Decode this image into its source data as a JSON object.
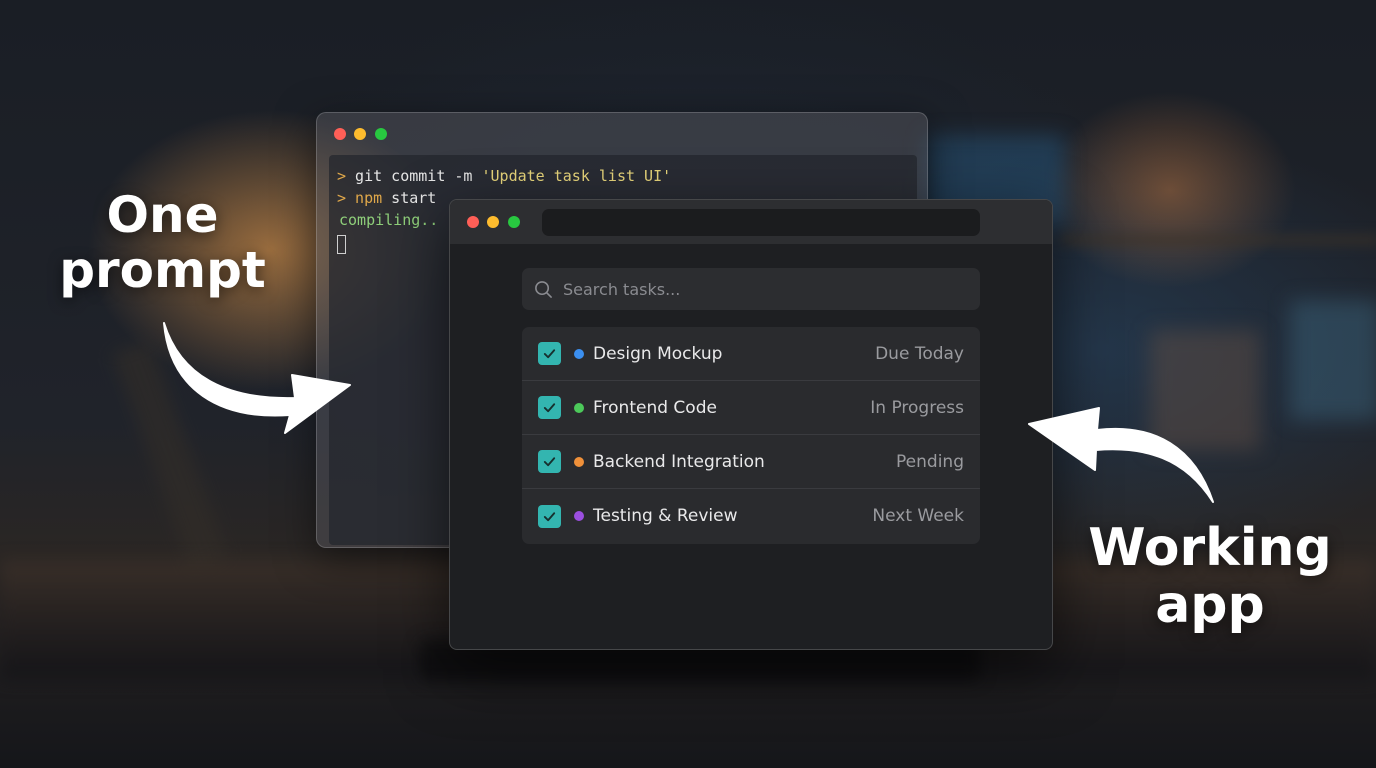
{
  "captions": {
    "left_line1": "One",
    "left_line2": "prompt",
    "right_line1": "Working",
    "right_line2": "app"
  },
  "terminal": {
    "lines": {
      "line1_prompt": ">",
      "line1_cmd": " git commit -m ",
      "line1_string": "'Update task list UI'",
      "line2_prompt": ">",
      "line2_cmd": " npm",
      "line2_rest": " start",
      "line3": "compiling.."
    }
  },
  "app": {
    "search": {
      "placeholder": "Search tasks..."
    },
    "tasks": [
      {
        "name": "Design Mockup",
        "status": "Due Today",
        "dot_color": "#3b8ff0",
        "checked": true
      },
      {
        "name": "Frontend Code",
        "status": "In Progress",
        "dot_color": "#4cc95a",
        "checked": true
      },
      {
        "name": "Backend Integration",
        "status": "Pending",
        "dot_color": "#f0913a",
        "checked": true
      },
      {
        "name": "Testing & Review",
        "status": "Next Week",
        "dot_color": "#9b4fe0",
        "checked": true
      }
    ]
  },
  "colors": {
    "check_accent": "#33b5b0",
    "traffic_red": "#ff5f57",
    "traffic_yellow": "#febc2e",
    "traffic_green": "#28c840"
  }
}
